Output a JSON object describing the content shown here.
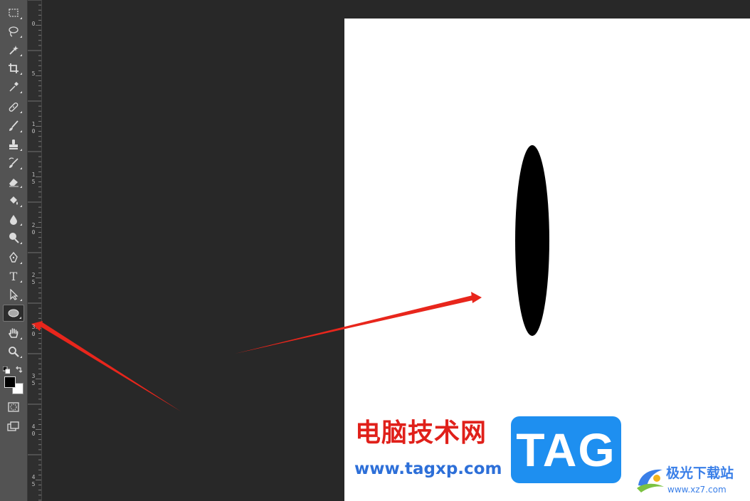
{
  "toolbar": {
    "tools": [
      {
        "name": "rectangular-marquee-tool",
        "icon": "marquee-icon"
      },
      {
        "name": "lasso-tool",
        "icon": "lasso-icon"
      },
      {
        "name": "magic-wand-tool",
        "icon": "magic-wand-icon"
      },
      {
        "name": "crop-tool",
        "icon": "crop-icon"
      },
      {
        "name": "eyedropper-tool",
        "icon": "eyedropper-icon"
      },
      {
        "name": "healing-brush-tool",
        "icon": "bandage-icon"
      },
      {
        "name": "brush-tool",
        "icon": "brush-icon"
      },
      {
        "name": "clone-stamp-tool",
        "icon": "stamp-icon"
      },
      {
        "name": "history-brush-tool",
        "icon": "history-brush-icon"
      },
      {
        "name": "eraser-tool",
        "icon": "eraser-icon"
      },
      {
        "name": "paint-bucket-tool",
        "icon": "paint-bucket-icon"
      },
      {
        "name": "blur-tool",
        "icon": "drop-icon"
      },
      {
        "name": "dodge-tool",
        "icon": "dodge-icon"
      },
      {
        "name": "pen-tool",
        "icon": "pen-icon"
      },
      {
        "name": "type-tool",
        "icon": "type-icon",
        "glyph": "T"
      },
      {
        "name": "path-selection-tool",
        "icon": "arrow-cursor-icon"
      },
      {
        "name": "ellipse-tool",
        "icon": "ellipse-icon",
        "active": true
      },
      {
        "name": "hand-tool",
        "icon": "hand-icon"
      },
      {
        "name": "zoom-tool",
        "icon": "zoom-icon"
      }
    ],
    "foreground_color": "#000000",
    "background_color": "#ffffff"
  },
  "ruler": {
    "labels": [
      [
        "0"
      ],
      [
        "5"
      ],
      [
        "1",
        "0"
      ],
      [
        "1",
        "5"
      ],
      [
        "2",
        "0"
      ],
      [
        "2",
        "5"
      ],
      [
        "3",
        "0"
      ],
      [
        "3",
        "5"
      ],
      [
        "4",
        "0"
      ],
      [
        "4",
        "5"
      ]
    ]
  },
  "watermark": {
    "site_cn": "电脑技术网",
    "site_url": "www.tagxp.com",
    "tag": "TAG",
    "site2_cn": "极光下载站",
    "site2_url": "www.xz7.com"
  },
  "colors": {
    "workspace": "#282828",
    "toolbar": "#535353",
    "document": "#ffffff",
    "ellipse_fill": "#000000",
    "arrow": "#e8261c"
  }
}
